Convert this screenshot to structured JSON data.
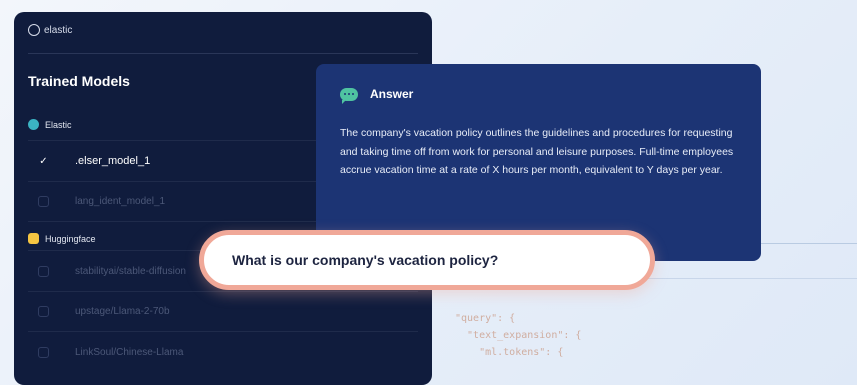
{
  "brand": {
    "name": "elastic"
  },
  "panel": {
    "title": "Trained Models",
    "groups": [
      {
        "name": "Elastic",
        "icon": "elastic-icon",
        "icon_color": "#3bb3c3",
        "items": [
          {
            "label": ".elser_model_1",
            "checked": true
          },
          {
            "label": "lang_ident_model_1",
            "checked": false
          }
        ]
      },
      {
        "name": "Huggingface",
        "icon": "huggingface-icon",
        "icon_color": "#f5c542",
        "items": [
          {
            "label": "stabilityai/stable-diffusion",
            "checked": false
          },
          {
            "label": "upstage/Llama-2-70b",
            "checked": false
          },
          {
            "label": "LinkSoul/Chinese-Llama",
            "checked": false
          }
        ]
      }
    ]
  },
  "answer": {
    "title": "Answer",
    "icon": "chat-bubble-icon",
    "text": "The company's vacation policy outlines the guidelines and procedures for requesting and taking time off from work for personal and leisure purposes. Full-time employees accrue vacation time at a rate of X hours per month, equivalent to Y days per year."
  },
  "query": {
    "text": "What is our company's vacation policy?"
  },
  "code": {
    "line1": "\"query\": {",
    "line2": "  \"text_expansion\": {",
    "line3": "    \"ml.tokens\": {"
  },
  "colors": {
    "panel_bg": "#101c3d",
    "answer_bg": "#1c3474",
    "query_border": "#f0a898",
    "accent_green": "#4fc3a1"
  }
}
